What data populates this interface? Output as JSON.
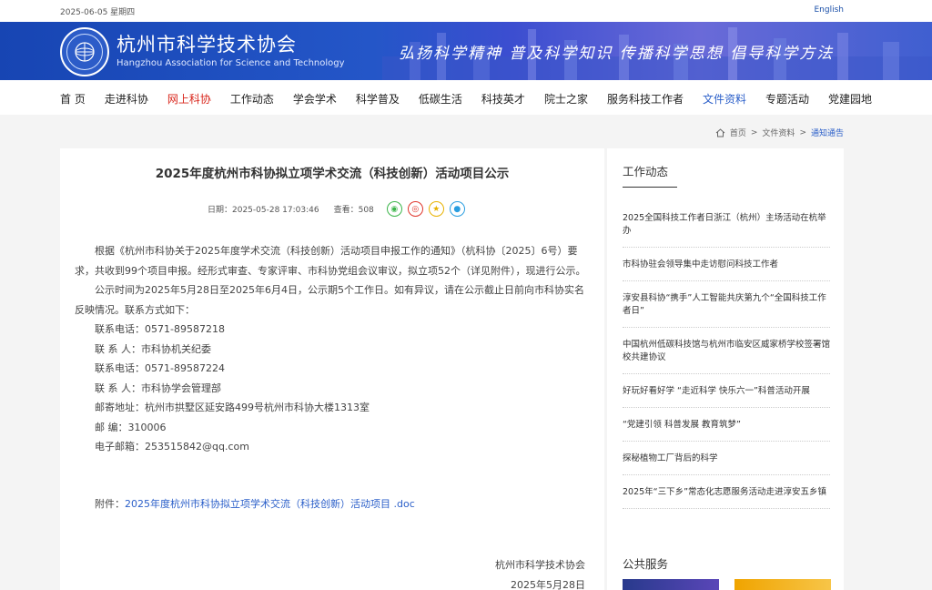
{
  "topbar": {
    "date": "2025-06-05 星期四",
    "lang_link": "English"
  },
  "header": {
    "name_cn": "杭州市科学技术协会",
    "name_en": "Hangzhou Association for Science and Technology",
    "slogan": "弘扬科学精神  普及科学知识  传播科学思想  倡导科学方法"
  },
  "nav": {
    "items": [
      "首 页",
      "走进科协",
      "网上科协",
      "工作动态",
      "学会学术",
      "科学普及",
      "低碳生活",
      "科技英才",
      "院士之家",
      "服务科技工作者",
      "文件资料",
      "专题活动",
      "党建园地"
    ]
  },
  "breadcrumb": {
    "home": "首页",
    "sep": ">",
    "level1": "文件资料",
    "level2": "通知通告"
  },
  "article": {
    "title": "2025年度杭州市科协拟立项学术交流（科技创新）活动项目公示",
    "date_label": "日期：2025-05-28 17:03:46",
    "views_label": "查看：508",
    "para1": "根据《杭州市科协关于2025年度学术交流（科技创新）活动项目申报工作的通知》（杭科协〔2025〕6号）要求，共收到99个项目申报。经形式审查、专家评审、市科协党组会议审议，拟立项52个（详见附件），现进行公示。",
    "para2": "公示时间为2025年5月28日至2025年6月4日，公示期5个工作日。如有异议，请在公示截止日前向市科协实名反映情况。联系方式如下：",
    "contacts": [
      "联系电话：0571-89587218",
      "联  系  人：市科协机关纪委",
      "联系电话：0571-89587224",
      "联  系  人：市科协学会管理部",
      "邮寄地址：杭州市拱墅区延安路499号杭州市科协大楼1313室",
      "邮      编：310006",
      "电子邮箱：253515842@qq.com"
    ],
    "attach_label": "附件：",
    "attach_link": "2025年度杭州市科协拟立项学术交流（科技创新）活动项目 .doc",
    "sign_org": "杭州市科学技术协会",
    "sign_date": "2025年5月28日"
  },
  "sidebar": {
    "heading": "工作动态",
    "news": [
      "2025全国科技工作者日浙江（杭州）主场活动在杭举办",
      "市科协驻会领导集中走访慰问科技工作者",
      "淳安县科协“携手”人工智能共庆第九个“全国科技工作者日”",
      "中国杭州低碳科技馆与杭州市临安区威家桥学校签署馆校共建协议",
      "好玩好看好学 “走近科学 快乐六一”科普活动开展",
      "“党建引领 科普发展 教育筑梦”",
      "探秘植物工厂背后的科学",
      "2025年“三下乡”常态化志愿服务活动走进淳安五乡镇"
    ],
    "heading2": "公共服务"
  },
  "icons": [
    "home-icon",
    "wechat-share-icon",
    "weibo-share-icon",
    "favorite-share-icon",
    "qq-share-icon"
  ],
  "colors": {
    "banner": "#1e4fbf",
    "nav_active": "#2b5fc9",
    "nav_hot": "#d9281e"
  }
}
